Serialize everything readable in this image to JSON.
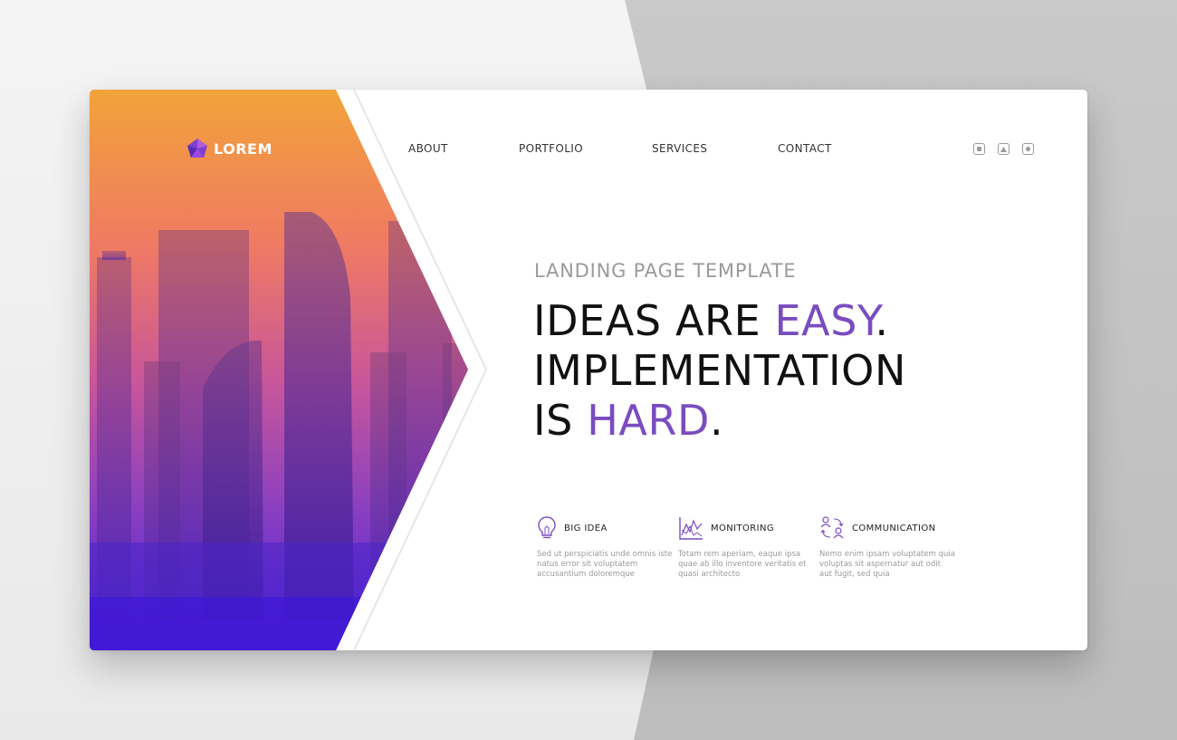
{
  "brand": {
    "logo_text": "LOREM"
  },
  "nav": {
    "items": [
      "ABOUT",
      "PORTFOLIO",
      "SERVICES",
      "CONTACT"
    ]
  },
  "window_icons": [
    "square-icon",
    "triangle-icon",
    "circle-icon"
  ],
  "hero": {
    "kicker": "LANDING PAGE TEMPLATE",
    "line1_prefix": "IDEAS ARE ",
    "line1_accent": "EASY",
    "line1_suffix": ".",
    "line2": "IMPLEMENTATION",
    "line3_prefix": "IS ",
    "line3_accent": "HARD",
    "line3_suffix": "."
  },
  "features": [
    {
      "icon": "lightbulb-icon",
      "title": "BIG IDEA",
      "desc": "Sed ut perspiciatis unde omnis iste natus error sit voluptatem accusantium doloremque"
    },
    {
      "icon": "chart-icon",
      "title": "MONITORING",
      "desc": "Totam rem aperiam, eaque ipsa quae ab illo inventore veritatis et quasi architecto"
    },
    {
      "icon": "people-exchange-icon",
      "title": "COMMUNICATION",
      "desc": "Nemo enim ipsam voluptatem quia voluptas sit aspernatur aut odit aut fugit, sed quia"
    }
  ],
  "colors": {
    "accent": "#7a4cc0",
    "gradient_top": "#f2a33a",
    "gradient_bottom": "#4a1de0"
  }
}
